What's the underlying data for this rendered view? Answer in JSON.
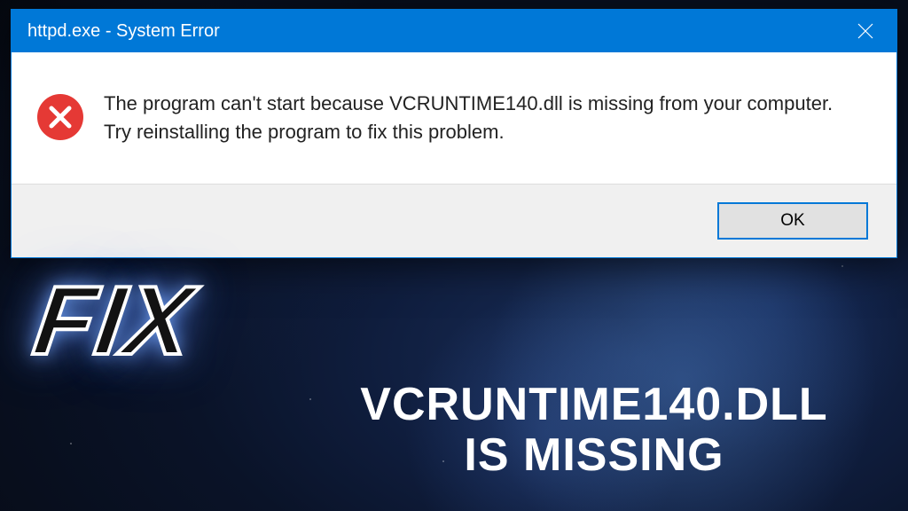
{
  "dialog": {
    "title": "httpd.exe - System Error",
    "message": "The program can't start because VCRUNTIME140.dll is missing from your computer. Try reinstalling the program to fix this problem.",
    "ok_label": "OK"
  },
  "overlay": {
    "fix_label": "FIX",
    "subtitle_line1": "VCRUNTIME140.DLL",
    "subtitle_line2": "IS MISSING"
  },
  "colors": {
    "titlebar": "#0078d7",
    "error_icon": "#e53935"
  }
}
